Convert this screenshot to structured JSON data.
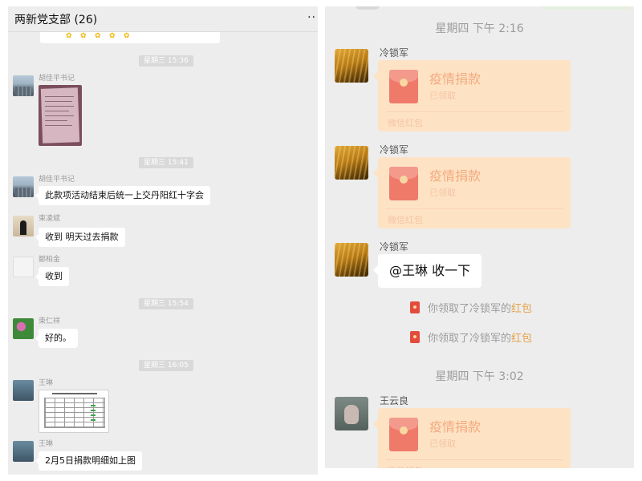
{
  "left": {
    "title": "两新党支部 (26)",
    "more_icon": "..",
    "messages": [
      {
        "time": "星期三 15:36",
        "sender": "胡佳平书记"
      },
      {
        "time": "星期三 15:41",
        "sender": "胡佳平书记",
        "text": "此款项活动结束后统一上交丹阳红十字会"
      },
      {
        "sender": "束凌斌",
        "text": "收到  明天过去捐款"
      },
      {
        "sender": "鄒柏金",
        "text": "收到"
      },
      {
        "time": "星期三 15:54",
        "sender": "束仁祥",
        "text": "好的。"
      },
      {
        "time": "星期三 16:05",
        "sender": "王琳"
      },
      {
        "sender": "王琳",
        "text": "2月5日捐款明细如上图"
      }
    ]
  },
  "right": {
    "time1": "星期四 下午 2:16",
    "time2": "星期四 下午 3:02",
    "sender_leng": "冷锁军",
    "sender_wang": "王云良",
    "packet_title": "疫情捐款",
    "packet_status": "已领取",
    "packet_label": "微信红包",
    "mention_text": "@王琳 收一下",
    "system_prefix": "你领取了冷锁军的",
    "system_highlight": "红包"
  }
}
